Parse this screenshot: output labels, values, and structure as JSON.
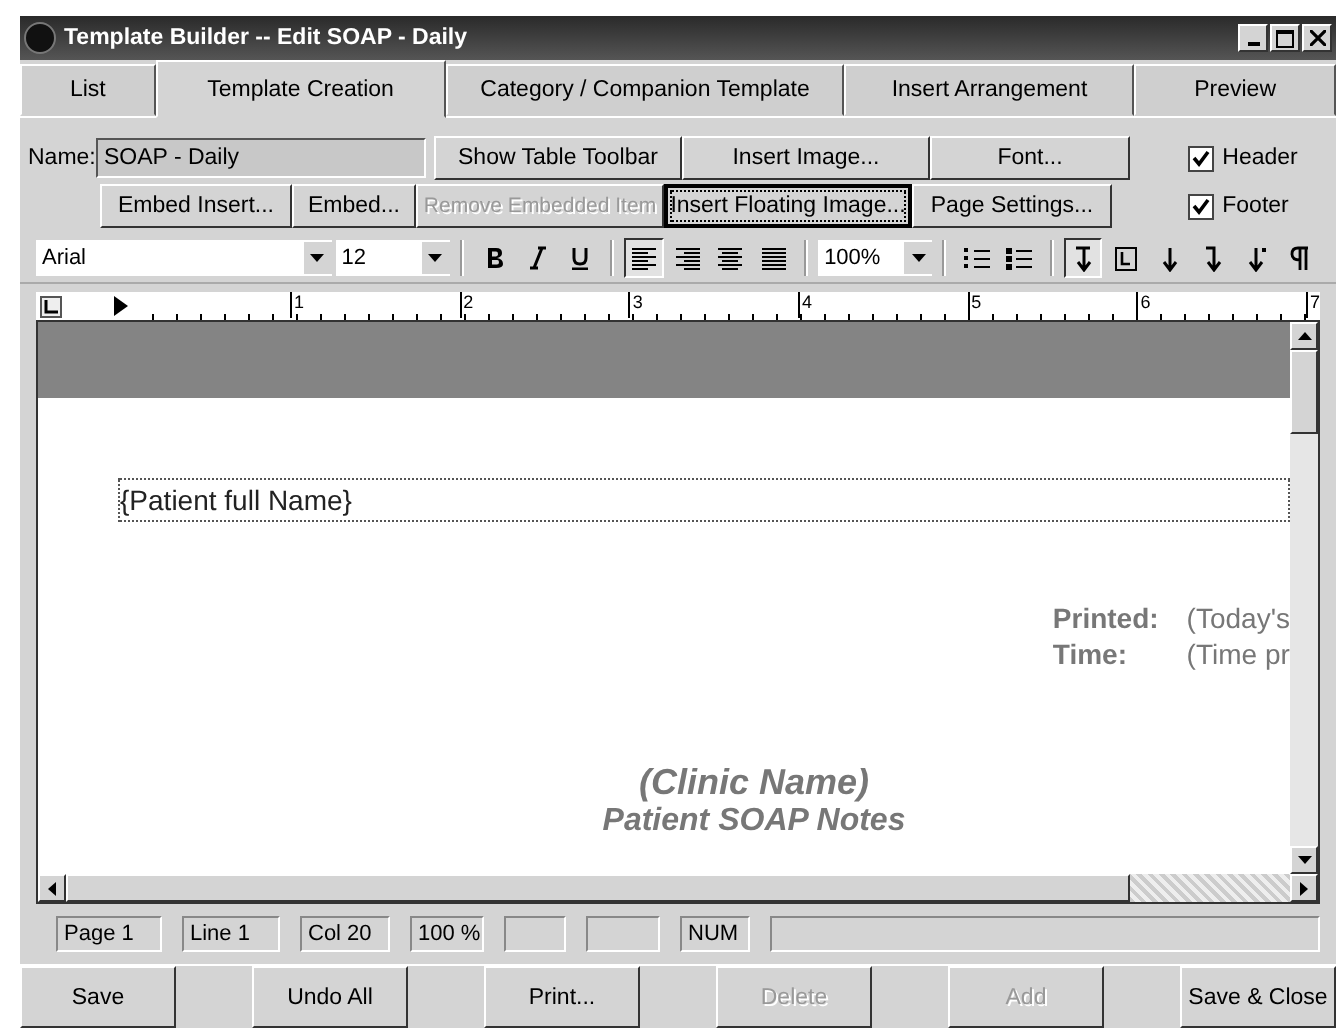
{
  "window": {
    "title": "Template Builder -- Edit SOAP - Daily"
  },
  "tabs": [
    {
      "label": "List",
      "selected": false
    },
    {
      "label": "Template Creation",
      "selected": true
    },
    {
      "label": "Category / Companion Template",
      "selected": false
    },
    {
      "label": "Insert Arrangement",
      "selected": false
    },
    {
      "label": "Preview",
      "selected": false
    }
  ],
  "name_field": {
    "label": "Name:",
    "value": "SOAP - Daily"
  },
  "buttons_row1": [
    {
      "label": "Show Table Toolbar",
      "disabled": false,
      "focused": false
    },
    {
      "label": "Insert Image...",
      "disabled": false,
      "focused": false
    },
    {
      "label": "Font...",
      "disabled": false,
      "focused": false
    }
  ],
  "buttons_row2": [
    {
      "label": "Embed Insert...",
      "disabled": false,
      "focused": false
    },
    {
      "label": "Embed...",
      "disabled": false,
      "focused": false
    },
    {
      "label": "Remove Embedded Item",
      "disabled": true,
      "focused": false
    },
    {
      "label": "Insert Floating Image...",
      "disabled": false,
      "focused": true
    },
    {
      "label": "Page Settings...",
      "disabled": false,
      "focused": false
    }
  ],
  "checkboxes": [
    {
      "label": "Header",
      "checked": true
    },
    {
      "label": "Footer",
      "checked": true
    }
  ],
  "toolbar": {
    "font": "Arial",
    "size": "12",
    "zoom": "100%",
    "format_buttons": [
      {
        "kind": "bold",
        "selected": false
      },
      {
        "kind": "italic",
        "selected": false
      },
      {
        "kind": "underline",
        "selected": false
      }
    ],
    "align_buttons": [
      {
        "kind": "left",
        "selected": true
      },
      {
        "kind": "right",
        "selected": false
      },
      {
        "kind": "center",
        "selected": false
      },
      {
        "kind": "justify",
        "selected": false
      }
    ],
    "list_buttons": [
      {
        "kind": "numbered",
        "selected": false
      },
      {
        "kind": "bulleted",
        "selected": false
      }
    ],
    "extra_buttons": [
      {
        "kind": "break",
        "selected": true
      },
      {
        "kind": "frame",
        "selected": false
      },
      {
        "kind": "down",
        "selected": false
      },
      {
        "kind": "downhook",
        "selected": false
      },
      {
        "kind": "downdot",
        "selected": false
      },
      {
        "kind": "pilcrow",
        "selected": false
      }
    ]
  },
  "ruler": {
    "marks": [
      "1",
      "2",
      "3",
      "4",
      "5",
      "6",
      "7"
    ]
  },
  "document": {
    "name_field": "{Patient full Name}",
    "printed_label": "Printed:",
    "printed_value": "(Today's",
    "time_label": "Time:",
    "time_value": "(Time pr",
    "clinic": "(Clinic Name)",
    "subtitle": "Patient SOAP Notes"
  },
  "status_bar": [
    {
      "text": "Page  1"
    },
    {
      "text": "Line  1"
    },
    {
      "text": "Col  20"
    },
    {
      "text": "100 %"
    },
    {
      "text": "NUM"
    }
  ],
  "bottom_buttons": [
    {
      "label": "Save",
      "disabled": false
    },
    {
      "label": "Undo All",
      "disabled": false
    },
    {
      "label": "Print...",
      "disabled": false
    },
    {
      "label": "Delete",
      "disabled": true
    },
    {
      "label": "Add",
      "disabled": true
    },
    {
      "label": "Save & Close",
      "disabled": false
    }
  ]
}
